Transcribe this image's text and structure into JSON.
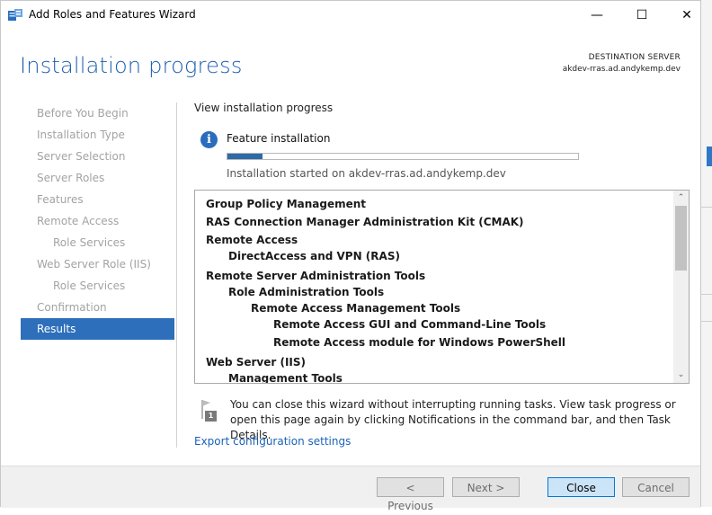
{
  "window": {
    "title": "Add Roles and Features Wizard",
    "minimize_glyph": "—",
    "maximize_glyph": "☐",
    "close_glyph": "✕"
  },
  "header": {
    "page_title": "Installation progress",
    "destination_label": "DESTINATION SERVER",
    "destination_server": "akdev-rras.ad.andykemp.dev"
  },
  "nav": {
    "items": [
      {
        "label": "Before You Begin"
      },
      {
        "label": "Installation Type"
      },
      {
        "label": "Server Selection"
      },
      {
        "label": "Server Roles"
      },
      {
        "label": "Features"
      },
      {
        "label": "Remote Access"
      },
      {
        "label": "Role Services"
      },
      {
        "label": "Web Server Role (IIS)"
      },
      {
        "label": "Role Services"
      },
      {
        "label": "Confirmation"
      },
      {
        "label": "Results"
      }
    ],
    "active_index": 10
  },
  "content": {
    "section_label": "View installation progress",
    "info_glyph": "i",
    "feature_label": "Feature installation",
    "progress_fraction": 0.1,
    "started_text": "Installation started on akdev-rras.ad.andykemp.dev",
    "features": [
      "Group Policy Management",
      "RAS Connection Manager Administration Kit (CMAK)",
      "Remote Access",
      "DirectAccess and VPN (RAS)",
      "Remote Server Administration Tools",
      "Role Administration Tools",
      "Remote Access Management Tools",
      "Remote Access GUI and Command-Line Tools",
      "Remote Access module for Windows PowerShell",
      "Web Server (IIS)",
      "Management Tools"
    ],
    "scroll_up_glyph": "⌃",
    "scroll_down_glyph": "⌄",
    "note_badge": "1",
    "note_text": "You can close this wizard without interrupting running tasks. View task progress or open this page again by clicking Notifications in the command bar, and then Task Details.",
    "export_link": "Export configuration settings"
  },
  "footer": {
    "previous": "< Previous",
    "next": "Next >",
    "close": "Close",
    "cancel": "Cancel"
  },
  "colors": {
    "accent": "#2d6fbb",
    "title_blue": "#1e5fae",
    "link_blue": "#1a63b7"
  }
}
